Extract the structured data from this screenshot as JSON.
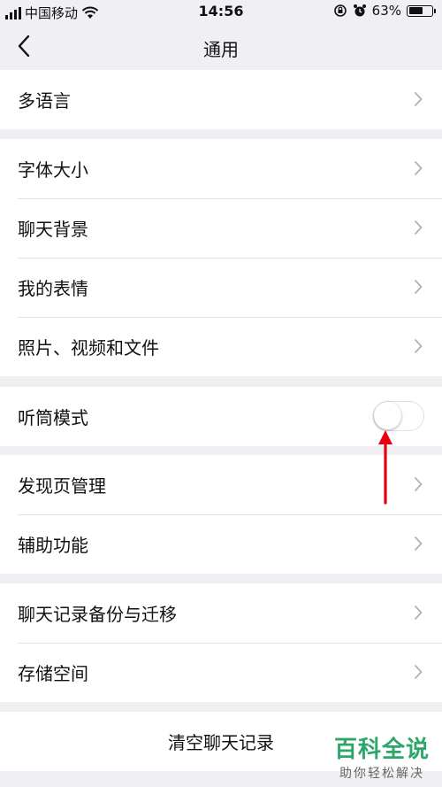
{
  "status_bar": {
    "carrier": "中国移动",
    "time": "14:56",
    "battery": "63%",
    "battery_level": 0.63
  },
  "nav": {
    "title": "通用",
    "back_icon": "chevron-left-icon"
  },
  "groups": {
    "language": {
      "label": "多语言"
    },
    "display": {
      "font_size": "字体大小",
      "chat_background": "聊天背景",
      "my_stickers": "我的表情",
      "media_files": "照片、视频和文件"
    },
    "earpiece": {
      "label": "听筒模式",
      "enabled": false
    },
    "discover": {
      "discover_manage": "发现页管理",
      "accessibility": "辅助功能"
    },
    "backup": {
      "chat_backup": "聊天记录备份与迁移",
      "storage": "存储空间"
    },
    "clear": {
      "label": "清空聊天记录"
    }
  },
  "watermark": {
    "title": "百科全说",
    "subtitle": "助你轻松解决"
  },
  "colors": {
    "background": "#efeff4",
    "arrow": "#e60012",
    "watermark": "#2ca66a"
  }
}
